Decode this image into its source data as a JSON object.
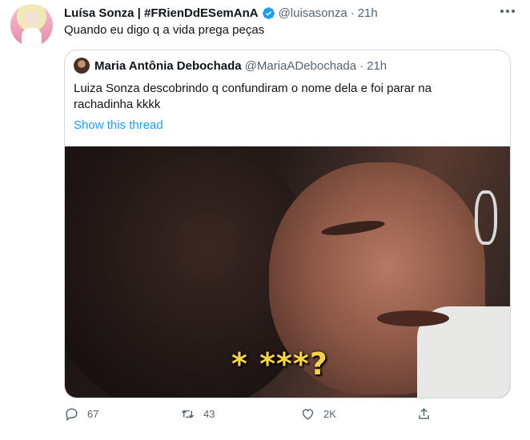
{
  "author": {
    "name": "Luísa Sonza | #FRienDdESemAnA",
    "handle": "@luisasonza",
    "separator": "·",
    "time": "21h"
  },
  "tweet_text": "Quando eu digo q a vida prega peças",
  "quoted": {
    "name": "Maria Antônia Debochada",
    "handle": "@MariaADebochada",
    "separator": "·",
    "time": "21h",
    "text": "Luiza Sonza descobrindo q confundiram o nome dela e foi parar na rachadinha kkkk",
    "show_thread": "Show this thread",
    "media_caption": "* ***?"
  },
  "actions": {
    "reply_count": "67",
    "retweet_count": "43",
    "like_count": "2K"
  },
  "colors": {
    "link": "#1d9bf0",
    "secondary_text": "#536471",
    "caption": "#f5d24a"
  },
  "icons": [
    "verified-badge-icon",
    "more-icon",
    "reply-icon",
    "retweet-icon",
    "like-icon",
    "share-icon"
  ]
}
